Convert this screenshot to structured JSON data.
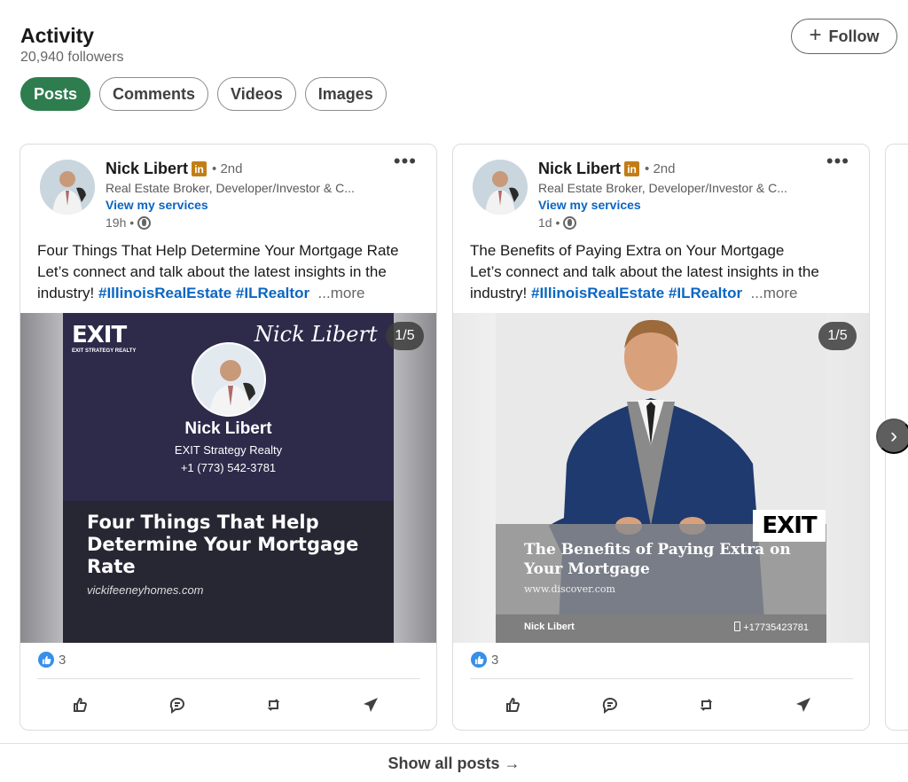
{
  "header": {
    "title": "Activity",
    "followers": "20,940 followers",
    "follow_label": "Follow",
    "plus_glyph": "+"
  },
  "tabs": [
    {
      "label": "Posts",
      "active": true
    },
    {
      "label": "Comments",
      "active": false
    },
    {
      "label": "Videos",
      "active": false
    },
    {
      "label": "Images",
      "active": false
    }
  ],
  "posts": [
    {
      "author": "Nick Libert",
      "li_badge": "in",
      "degree": "• 2nd",
      "headline": "Real Estate Broker, Developer/Investor & C...",
      "services": "View my services",
      "time": "19h •",
      "text_line1": "Four Things That Help Determine Your Mortgage Rate",
      "text_line2": "Let’s connect and talk about the latest insights in the industry!",
      "hashtags": "#IllinoisRealEstate #ILRealtor",
      "more": "...more",
      "counter": "1/5",
      "media": {
        "logo": "EXIT",
        "logo_sub": "EXIT STRATEGY REALTY",
        "script_name": "Nick Libert",
        "name": "Nick Libert",
        "company": "EXIT Strategy Realty",
        "phone": "+1 (773) 542-3781",
        "headline": "Four Things That Help Determine Your Mortgage Rate",
        "site": "vickifeeneyhomes.com"
      },
      "reactions": "3"
    },
    {
      "author": "Nick Libert",
      "li_badge": "in",
      "degree": "• 2nd",
      "headline": "Real Estate Broker, Developer/Investor & C...",
      "services": "View my services",
      "time": "1d •",
      "text_line1": "The Benefits of Paying Extra on Your Mortgage",
      "text_line2": "Let’s connect and talk about the latest insights in the industry!",
      "hashtags": "#IllinoisRealEstate #ILRealtor",
      "more": "...more",
      "counter": "1/5",
      "media": {
        "logo": "EXIT",
        "headline": "The Benefits of Paying Extra on Your Mortgage",
        "site": "www.discover.com",
        "name": "Nick Libert",
        "phone": "+17735423781"
      },
      "reactions": "3"
    }
  ],
  "carousel": {
    "next_glyph": "›"
  },
  "show_all": "Show all posts →",
  "colors": {
    "brand_green": "#2e7d4f",
    "link_blue": "#0a66c2",
    "like_blue": "#378fe9"
  },
  "icons": [
    "plus-icon",
    "linkedin-icon",
    "globe-icon",
    "more-icon",
    "like-icon",
    "comment-icon",
    "repost-icon",
    "send-icon",
    "chevron-right-icon",
    "arrow-right-icon"
  ]
}
